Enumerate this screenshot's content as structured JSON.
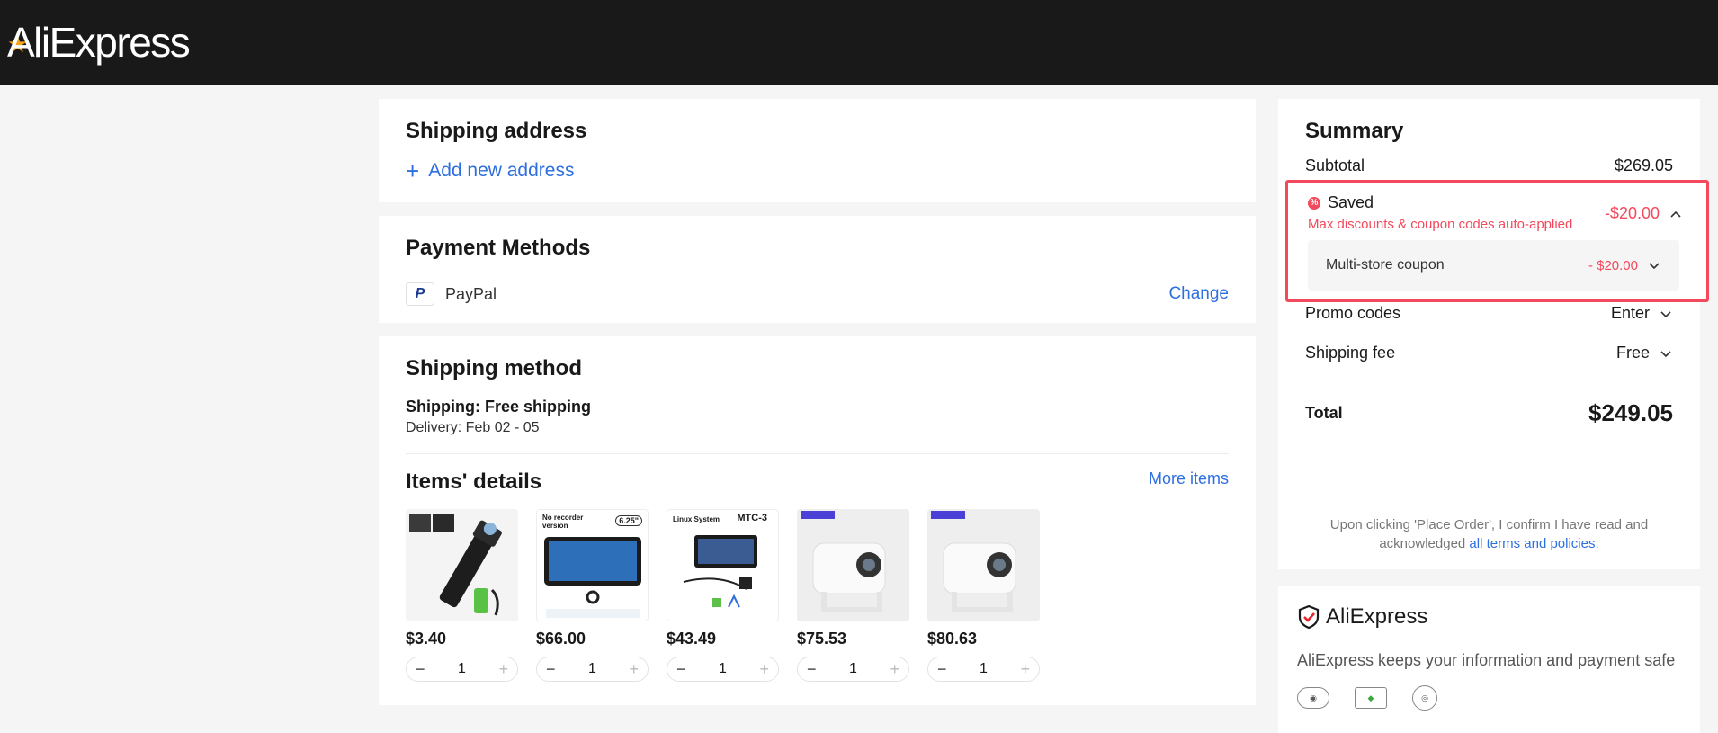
{
  "brand": {
    "logo_text": "AliExpress"
  },
  "shipping_address": {
    "title": "Shipping address",
    "add_label": "Add new address"
  },
  "payment": {
    "title": "Payment Methods",
    "method": "PayPal",
    "change_label": "Change"
  },
  "shipping_method": {
    "title": "Shipping method",
    "shipping_line": "Shipping: Free shipping",
    "delivery_line": "Delivery: Feb 02 - 05"
  },
  "items_details": {
    "title": "Items' details",
    "more_label": "More items",
    "items": [
      {
        "price": "$3.40",
        "qty": "1",
        "icon": "flashlight-product-icon"
      },
      {
        "price": "$66.00",
        "qty": "1",
        "icon": "car-display-product-icon",
        "thumb_text": "No recorder version",
        "badge": "6.25\""
      },
      {
        "price": "$43.49",
        "qty": "1",
        "icon": "car-display-product-icon",
        "thumb_text": "Linux System",
        "badge": "MTC-3"
      },
      {
        "price": "$75.53",
        "qty": "1",
        "icon": "projector-product-icon"
      },
      {
        "price": "$80.63",
        "qty": "1",
        "icon": "projector-product-icon"
      }
    ]
  },
  "summary": {
    "title": "Summary",
    "subtotal_label": "Subtotal",
    "subtotal_value": "$269.05",
    "saved_label": "Saved",
    "saved_value": "-$20.00",
    "saved_sub": "Max discounts & coupon codes auto-applied",
    "coupon_label": "Multi-store coupon",
    "coupon_value": "- $20.00",
    "promo_label": "Promo codes",
    "promo_value": "Enter",
    "shipping_label": "Shipping fee",
    "shipping_value": "Free",
    "total_label": "Total",
    "total_value": "$249.05",
    "terms_text": "Upon clicking 'Place Order', I confirm I have read and acknowledged",
    "terms_link": "all terms and policies."
  },
  "safe": {
    "logo_text": "AliExpress",
    "text": "AliExpress keeps your information and payment safe"
  },
  "colors": {
    "accent_red": "#f3495c",
    "link_blue": "#2e6fe0",
    "header_bg": "#191919"
  }
}
